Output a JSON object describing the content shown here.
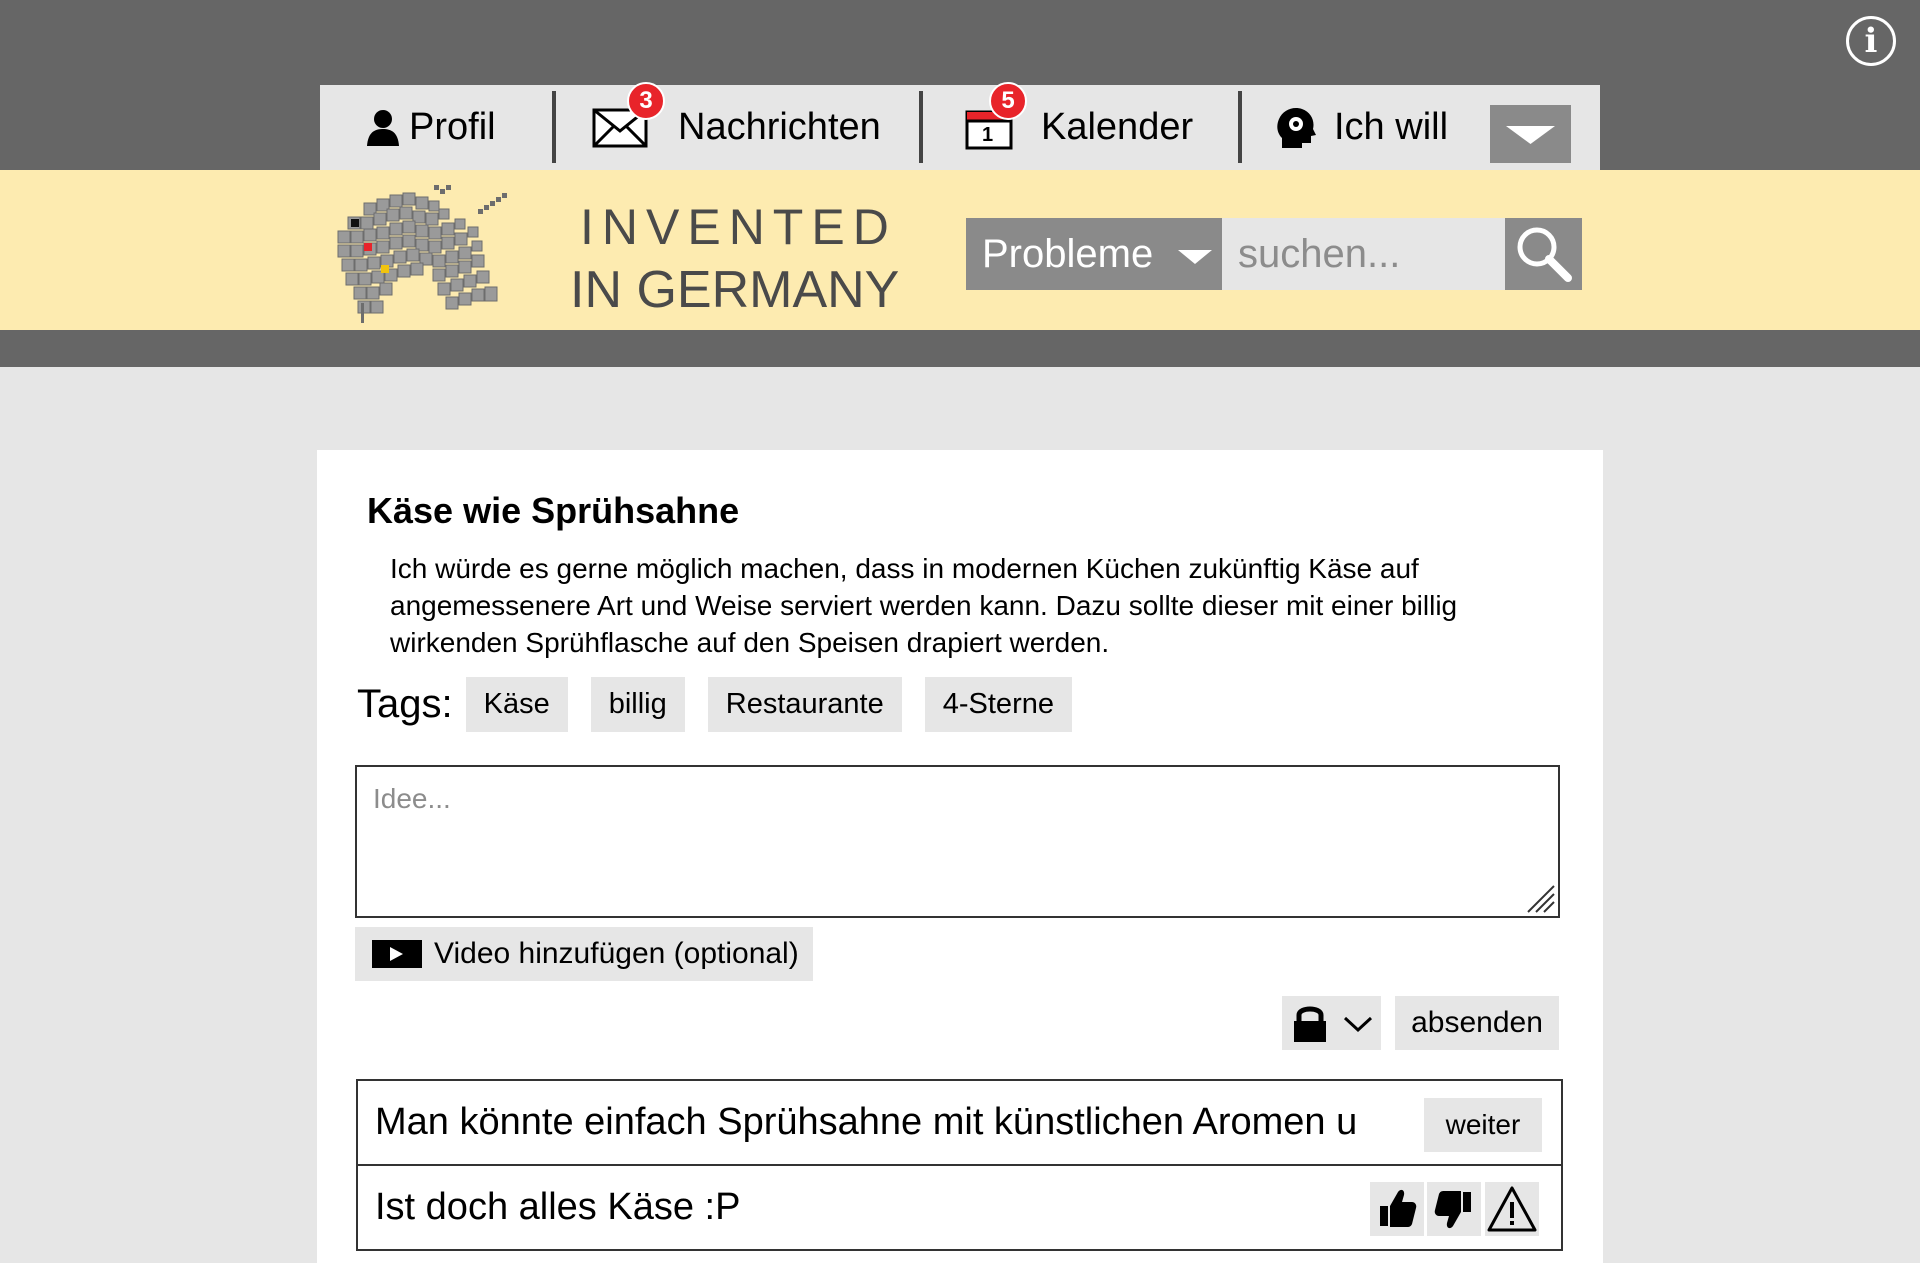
{
  "header": {
    "info_label": "i",
    "nav": [
      {
        "label": "Profil",
        "icon": "user-icon"
      },
      {
        "label": "Nachrichten",
        "icon": "mail-icon",
        "badge": "3"
      },
      {
        "label": "Kalender",
        "icon": "calendar-icon",
        "badge": "5",
        "calendar_day": "1"
      },
      {
        "label": "Ich will",
        "icon": "head-gear-icon"
      }
    ],
    "dropdown_icon": "chevron-down-icon"
  },
  "brand": {
    "line1": "INVENTED",
    "line2": "IN GERMANY",
    "logo_icon": "unicorn-logo"
  },
  "search": {
    "category": "Probleme",
    "placeholder": "suchen...",
    "button_icon": "search-icon"
  },
  "problem": {
    "title": "Käse wie Sprühsahne",
    "description": "Ich würde es gerne möglich machen, dass in modernen  Küchen zukünftig Käse auf angemessenere Art und Weise serviert werden kann. Dazu sollte dieser mit einer billig wirkenden Sprühflasche auf den Speisen drapiert werden.",
    "tags_label": "Tags:",
    "tags": [
      "Käse",
      "billig",
      "Restaurante",
      "4-Sterne"
    ]
  },
  "idea_form": {
    "placeholder": "Idee...",
    "video_label": "Video hinzufügen (optional)",
    "submit_label": "absenden",
    "privacy_icon": "lock-icon"
  },
  "answers": [
    {
      "text": "Man könnte einfach Sprühsahne mit künstlichen Aromen u",
      "more_label": "weiter"
    },
    {
      "text": "Ist doch alles Käse :P",
      "actions": [
        "thumbs-up-icon",
        "thumbs-down-icon",
        "warning-icon"
      ]
    }
  ],
  "colors": {
    "header_bg": "#666666",
    "brand_bar": "#fdebb0",
    "nav_bg": "#e6e6e6",
    "button_grey": "#8a8a8a",
    "badge_red": "#e8242a"
  }
}
